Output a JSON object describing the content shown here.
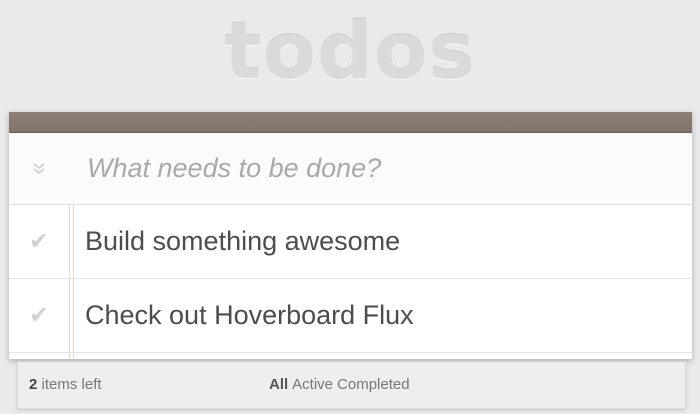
{
  "app": {
    "title": "todos"
  },
  "new_todo": {
    "placeholder": "What needs to be done?",
    "value": ""
  },
  "todos": [
    {
      "label": "Build something awesome",
      "completed": false
    },
    {
      "label": "Check out Hoverboard Flux",
      "completed": false
    }
  ],
  "footer": {
    "count": "2",
    "count_suffix": " items left",
    "filters": [
      {
        "label": "All",
        "selected": true
      },
      {
        "label": "Active",
        "selected": false
      },
      {
        "label": "Completed",
        "selected": false
      }
    ]
  },
  "icons": {
    "toggle_all": "chevrons-down-icon",
    "complete": "checkmark-icon"
  },
  "colors": {
    "header_bar": "#8e7e73",
    "background": "#eaeaea",
    "title": "#dadada",
    "text": "#4d4d4d",
    "placeholder": "#a9a9a9"
  }
}
